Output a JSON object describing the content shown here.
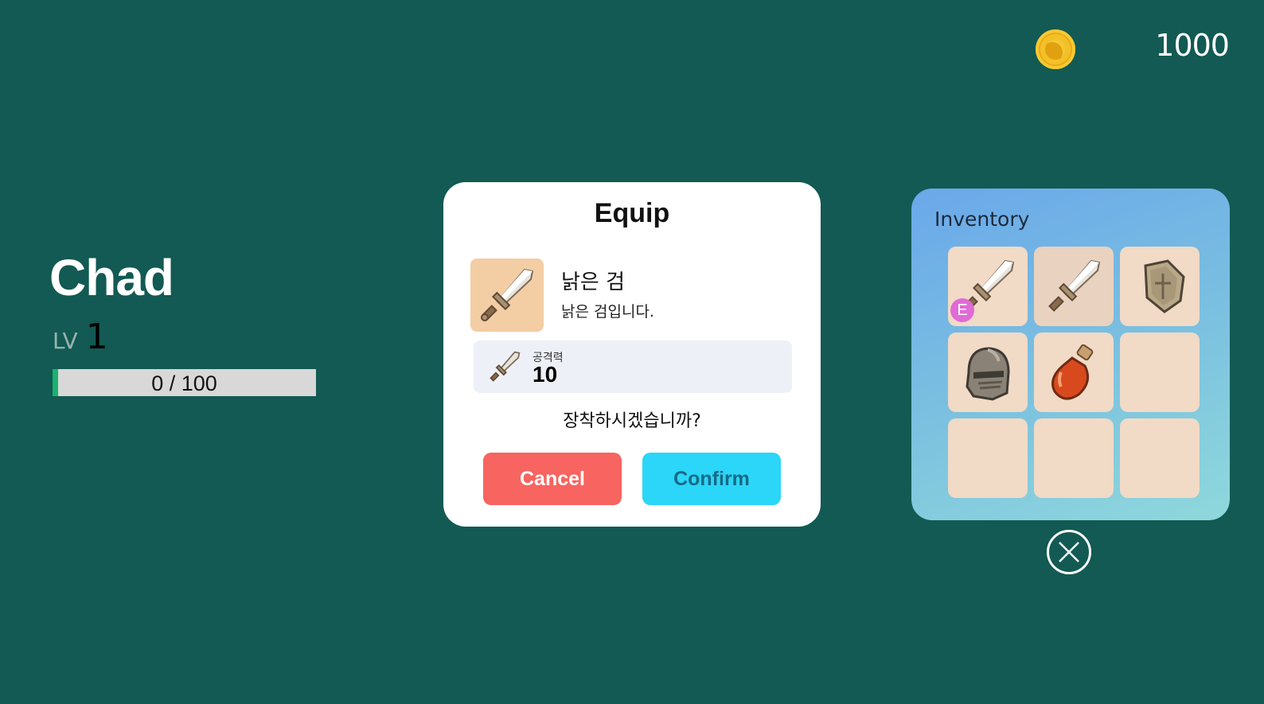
{
  "currency": {
    "icon": "gold-coin-icon",
    "amount": "1000"
  },
  "player": {
    "name": "Chad",
    "level_label": "LV",
    "level": "1",
    "xp_text": "0 / 100",
    "xp_fraction": 0.02,
    "xp_color": "#19b26e"
  },
  "equip_dialog": {
    "title": "Equip",
    "item_name": "낡은 검",
    "item_description": "낡은 검입니다.",
    "item_icon": "sword-icon",
    "stat_label": "공격력",
    "stat_value": "10",
    "question": "장착하시겠습니까?",
    "cancel_label": "Cancel",
    "confirm_label": "Confirm",
    "cancel_color": "#f8645f",
    "confirm_color": "#2bd6f8"
  },
  "inventory": {
    "title": "Inventory",
    "equipped_badge": "E",
    "slots": [
      {
        "item": "sword-icon",
        "equipped": true
      },
      {
        "item": "sword-icon",
        "equipped": false
      },
      {
        "item": "shield-icon",
        "equipped": false
      },
      {
        "item": "helmet-icon",
        "equipped": false
      },
      {
        "item": "potion-icon",
        "equipped": false
      },
      {
        "item": null,
        "equipped": false
      },
      {
        "item": null,
        "equipped": false
      },
      {
        "item": null,
        "equipped": false
      },
      {
        "item": null,
        "equipped": false
      }
    ]
  },
  "close_icon": "close-circle-icon"
}
